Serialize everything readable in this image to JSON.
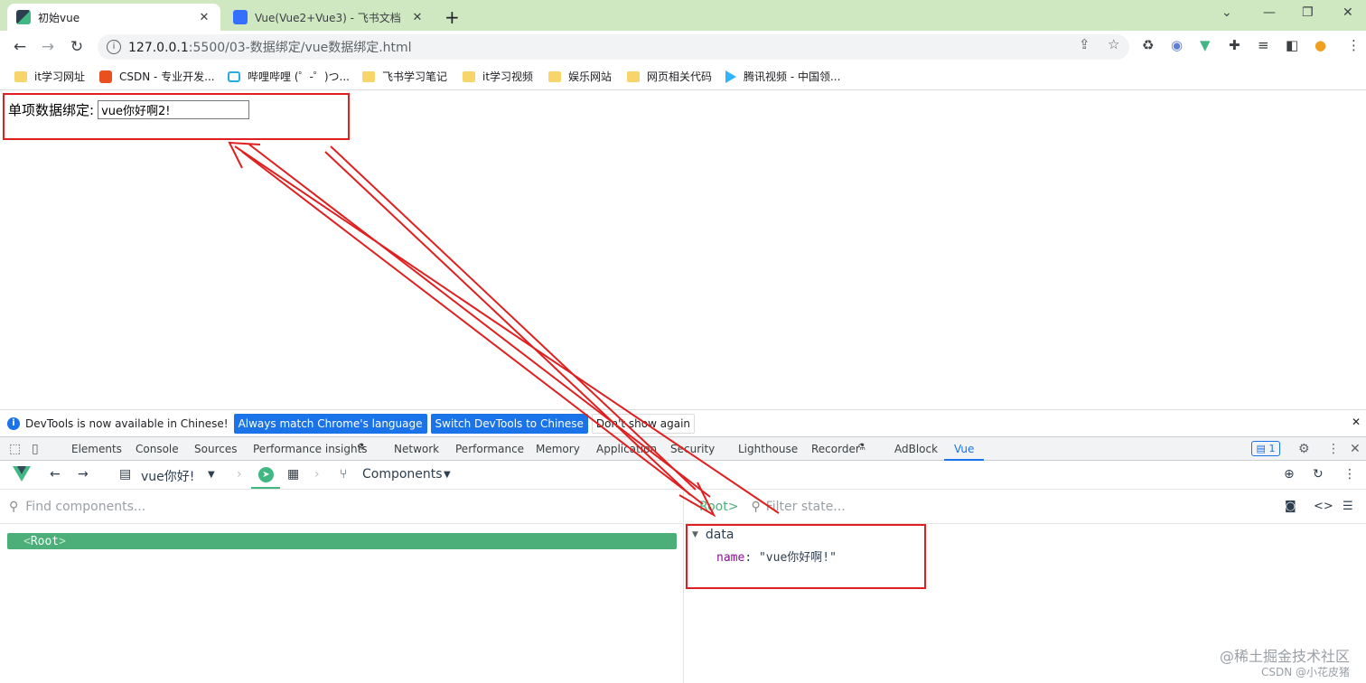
{
  "browser": {
    "tabs": [
      {
        "title": "初始vue",
        "close": "✕"
      },
      {
        "title": "Vue(Vue2+Vue3) - 飞书文档",
        "close": "✕"
      }
    ],
    "new_tab": "+",
    "url_host": "127.0.0.1",
    "url_path": ":5500/03-数据绑定/vue数据绑定.html",
    "bookmarks": [
      {
        "label": "it学习网址",
        "icon": "folder-icon"
      },
      {
        "label": "CSDN - 专业开发...",
        "icon": "csdn-icon"
      },
      {
        "label": "哔哩哔哩 (゜-゜)つ...",
        "icon": "bilibili-icon"
      },
      {
        "label": "飞书学习笔记",
        "icon": "folder-icon"
      },
      {
        "label": "it学习视频",
        "icon": "folder-icon"
      },
      {
        "label": "娱乐网站",
        "icon": "folder-icon"
      },
      {
        "label": "网页相关代码",
        "icon": "folder-icon"
      },
      {
        "label": "腾讯视频 - 中国领...",
        "icon": "tencent-video-icon"
      }
    ]
  },
  "page": {
    "label": "单项数据绑定:",
    "input_value": "vue你好啊2!"
  },
  "devtools": {
    "infobar": {
      "message": "DevTools is now available in Chinese!",
      "btn_match": "Always match Chrome's language",
      "btn_switch": "Switch DevTools to Chinese",
      "btn_dismiss": "Don't show again"
    },
    "tabs": [
      "Elements",
      "Console",
      "Sources",
      "Performance insights",
      "Network",
      "Performance",
      "Memory",
      "Application",
      "Security",
      "Lighthouse",
      "Recorder",
      "AdBlock",
      "Vue"
    ],
    "issues_count": "1"
  },
  "vue_devtools": {
    "app_name": "vue你好!",
    "components_label": "Components",
    "find_placeholder": "Find components...",
    "root_name": "Root",
    "root_crumb": "Root>",
    "filter_placeholder": "Filter state...",
    "data_section": "data",
    "prop_key": "name",
    "prop_value": "\"vue你好啊!\""
  },
  "watermark": {
    "line1": "@稀土掘金技术社区",
    "line2": "CSDN @小花皮猪"
  },
  "colors": {
    "annotation": "#e02020",
    "vue_green": "#41b883",
    "root_row": "#4caf79",
    "tab_strip": "#cfe8c1"
  }
}
